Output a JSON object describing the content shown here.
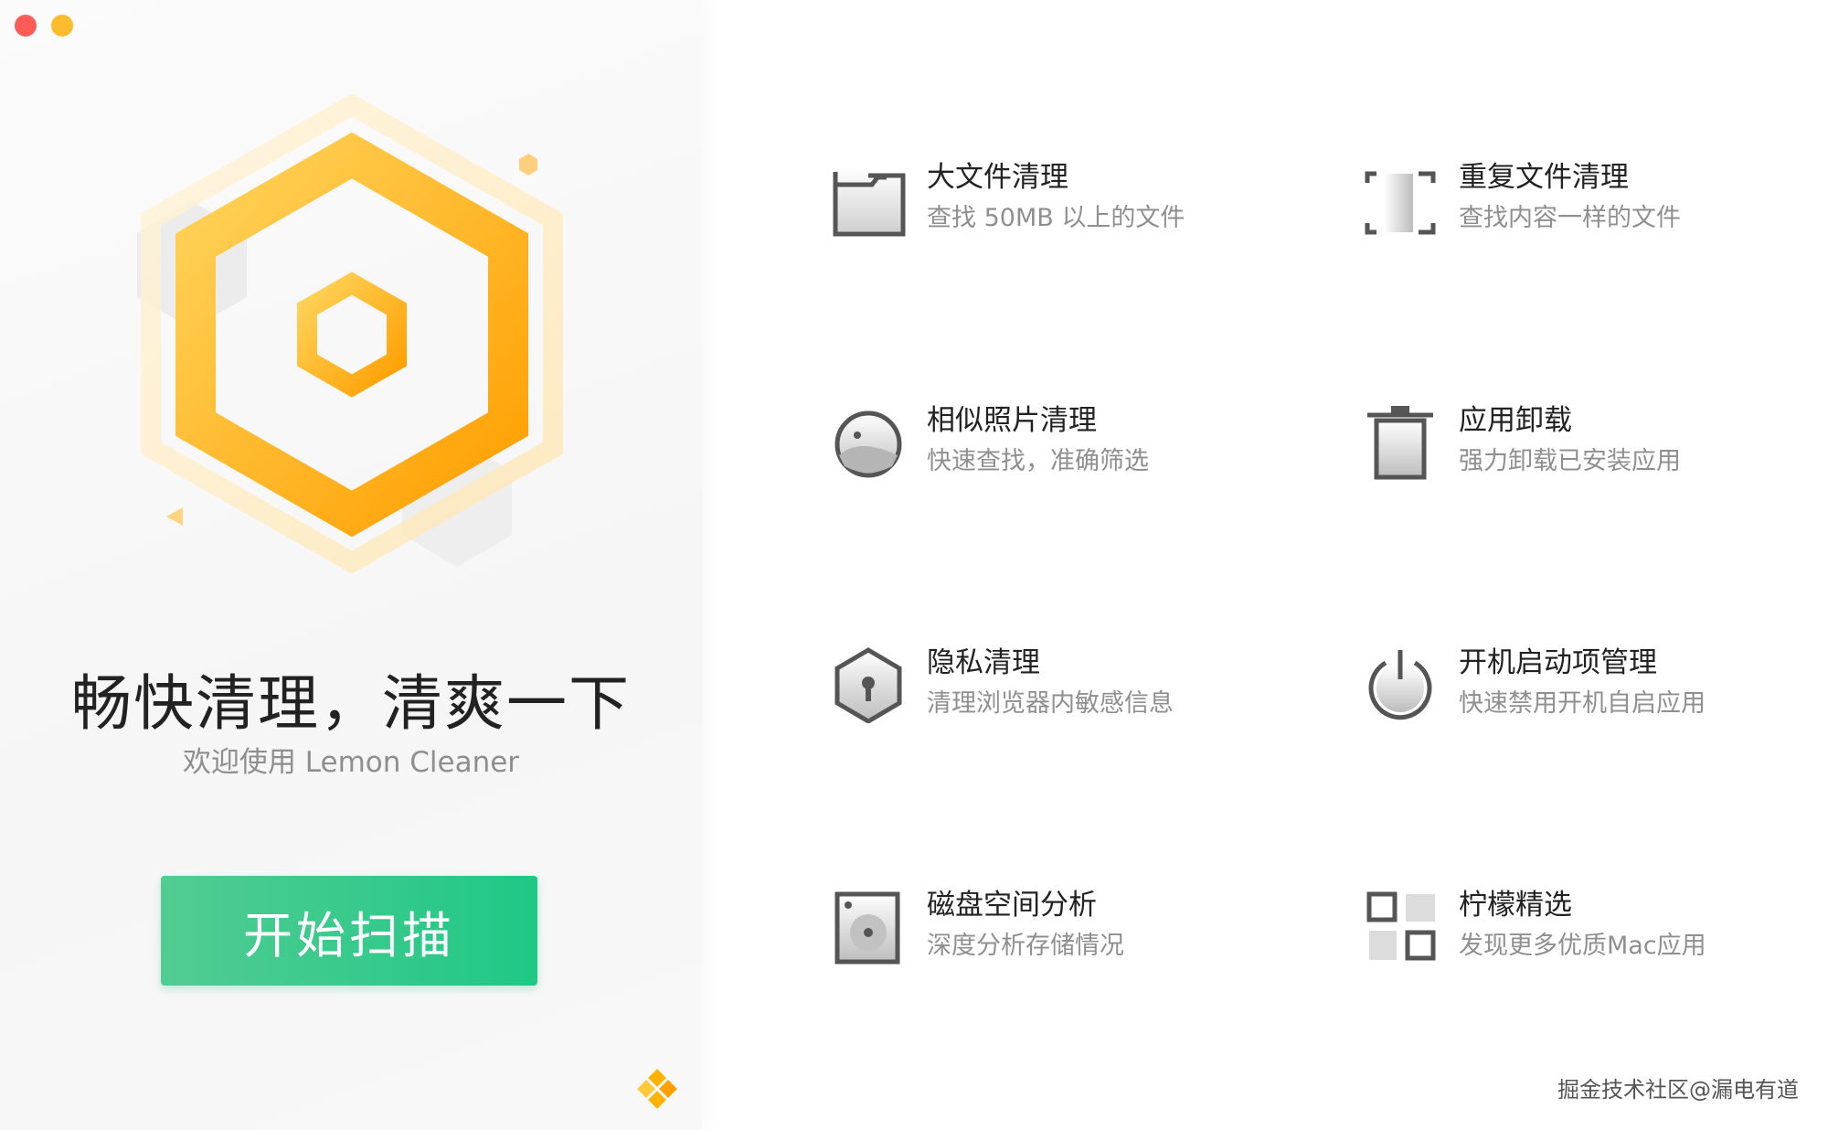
{
  "window": {
    "controls": [
      "close",
      "minimize"
    ]
  },
  "left_panel": {
    "headline": "畅快清理，清爽一下",
    "subtitle": "欢迎使用 Lemon Cleaner",
    "scan_button": "开始扫描"
  },
  "features": [
    {
      "id": "large-file",
      "icon": "folder-icon",
      "title": "大文件清理",
      "desc": "查找 50MB 以上的文件"
    },
    {
      "id": "duplicate-file",
      "icon": "duplicate-frame-icon",
      "title": "重复文件清理",
      "desc": "查找内容一样的文件"
    },
    {
      "id": "similar-photo",
      "icon": "photo-icon",
      "title": "相似照片清理",
      "desc": "快速查找，准确筛选"
    },
    {
      "id": "uninstall",
      "icon": "trash-icon",
      "title": "应用卸载",
      "desc": "强力卸载已安装应用"
    },
    {
      "id": "privacy",
      "icon": "privacy-lock-icon",
      "title": "隐私清理",
      "desc": "清理浏览器内敏感信息"
    },
    {
      "id": "startup",
      "icon": "power-icon",
      "title": "开机启动项管理",
      "desc": "快速禁用开机自启应用"
    },
    {
      "id": "disk",
      "icon": "disk-icon",
      "title": "磁盘空间分析",
      "desc": "深度分析存储情况"
    },
    {
      "id": "lemon-picks",
      "icon": "app-grid-icon",
      "title": "柠檬精选",
      "desc": "发现更多优质Mac应用"
    }
  ],
  "watermark": "掘金技术社区@漏电有道",
  "colors": {
    "accent_green": "#1fc886",
    "accent_orange": "#ffa500",
    "close": "#fd5d56",
    "minimize": "#fdbc2e"
  }
}
